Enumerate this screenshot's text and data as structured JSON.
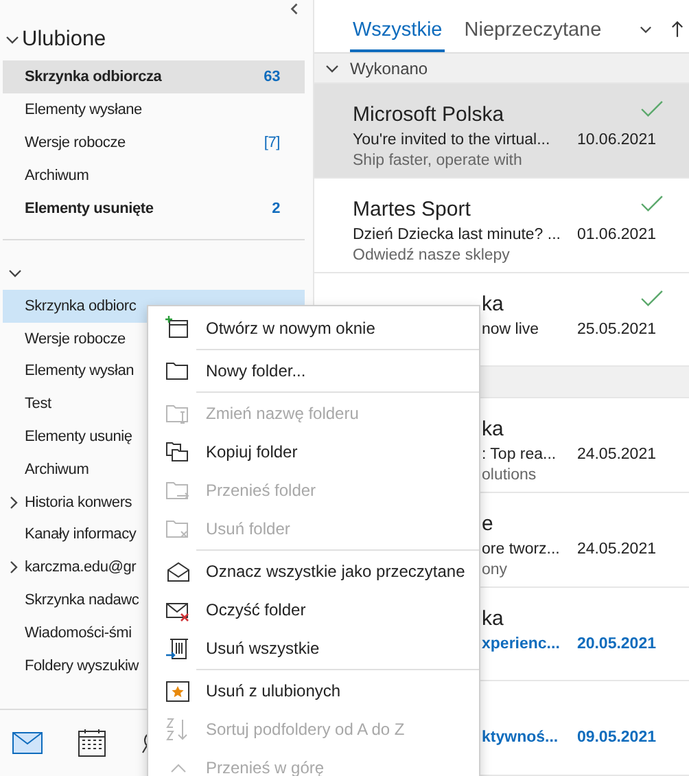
{
  "favorites": {
    "title": "Ulubione",
    "items": [
      {
        "label": "Skrzynka odbiorcza",
        "count": "63",
        "selected": true,
        "bold": true
      },
      {
        "label": "Elementy wysłane",
        "selected": false,
        "bold": false
      },
      {
        "label": "Wersje robocze",
        "count": "[7]",
        "selected": false,
        "bold": false
      },
      {
        "label": "Archiwum",
        "selected": false,
        "bold": false
      },
      {
        "label": "Elementy usunięte",
        "count": "2",
        "selected": false,
        "bold": true
      }
    ]
  },
  "account": {
    "folders": [
      {
        "label": "Skrzynka odbiorc",
        "selected": true
      },
      {
        "label": "Wersje robocze",
        "selected": false
      },
      {
        "label": "Elementy wysłan",
        "selected": false
      },
      {
        "label": "Test",
        "selected": false
      },
      {
        "label": "Elementy usunię",
        "selected": false
      },
      {
        "label": "Archiwum",
        "selected": false
      },
      {
        "label": "Historia konwers",
        "selected": false,
        "has_children": true
      },
      {
        "label": "Kanały informacy",
        "selected": false
      },
      {
        "label": "karczma.edu@gr",
        "selected": false,
        "has_children": true
      },
      {
        "label": "Skrzynka nadawc",
        "selected": false
      },
      {
        "label": "Wiadomości-śmi",
        "selected": false
      },
      {
        "label": "Foldery wyszukiw",
        "selected": false
      }
    ]
  },
  "nav": [
    {
      "kind": "mail",
      "selected": true
    },
    {
      "kind": "calendar",
      "selected": false
    },
    {
      "kind": "people",
      "selected": false
    }
  ],
  "tabs": [
    {
      "label": "Wszystkie",
      "selected": true
    },
    {
      "label": "Nieprzeczytane",
      "selected": false
    }
  ],
  "groups": [
    {
      "title": "Wykonano",
      "messages": [
        {
          "sender": "Microsoft Polska",
          "subject": "You're invited to the virtual...",
          "date": "10.06.2021",
          "preview": "Ship faster, operate with",
          "selected": true,
          "done": true,
          "unread": false,
          "occluded": false
        },
        {
          "sender": "Martes Sport",
          "subject": "Dzień Dziecka last minute? ...",
          "date": "01.06.2021",
          "preview": "Odwiedź nasze sklepy",
          "selected": false,
          "done": true,
          "unread": false,
          "occluded": false
        },
        {
          "sender": "ka",
          "subject": "now live",
          "date": "25.05.2021",
          "selected": false,
          "done": true,
          "unread": false,
          "occluded": true
        }
      ]
    },
    {
      "messages": [
        {
          "sender": "ka",
          "subject": ": Top rea...",
          "date": "24.05.2021",
          "preview": "olutions",
          "selected": false,
          "done": false,
          "unread": false,
          "occluded": true
        },
        {
          "sender": "e",
          "subject": "ore tworz...",
          "date": "24.05.2021",
          "preview": "ony",
          "selected": false,
          "done": false,
          "unread": false,
          "occluded": true
        },
        {
          "sender": "ka",
          "subject": "xperienc...",
          "date": "20.05.2021",
          "selected": false,
          "done": false,
          "unread": true,
          "occluded": true
        },
        {
          "subject": "ktywnoś...",
          "date": "09.05.2021",
          "selected": false,
          "done": false,
          "unread": true,
          "occluded": true
        }
      ]
    }
  ],
  "context_menu": {
    "groups": [
      [
        {
          "label": "Otwórz w nowym oknie",
          "kind": "open-new",
          "disabled": false
        }
      ],
      [
        {
          "label": "Nowy folder...",
          "kind": "new-folder",
          "disabled": false
        }
      ],
      [
        {
          "label": "Zmień nazwę folderu",
          "kind": "rename",
          "disabled": true
        },
        {
          "label": "Kopiuj folder",
          "kind": "copy",
          "disabled": false
        },
        {
          "label": "Przenieś folder",
          "kind": "move",
          "disabled": true
        },
        {
          "label": "Usuń folder",
          "kind": "delete-folder",
          "disabled": true
        }
      ],
      [
        {
          "label": "Oznacz wszystkie jako przeczytane",
          "kind": "mark-read",
          "disabled": false
        },
        {
          "label": "Oczyść folder",
          "kind": "clear",
          "disabled": false
        },
        {
          "label": "Usuń wszystkie",
          "kind": "delete-all",
          "disabled": false
        }
      ],
      [
        {
          "label": "Usuń z ulubionych",
          "kind": "unfavorite",
          "disabled": false
        },
        {
          "label": "Sortuj podfoldery od A do Z",
          "kind": "sort",
          "disabled": true
        },
        {
          "label": "Przenieś w górę",
          "kind": "move-up",
          "disabled": true
        }
      ]
    ]
  }
}
